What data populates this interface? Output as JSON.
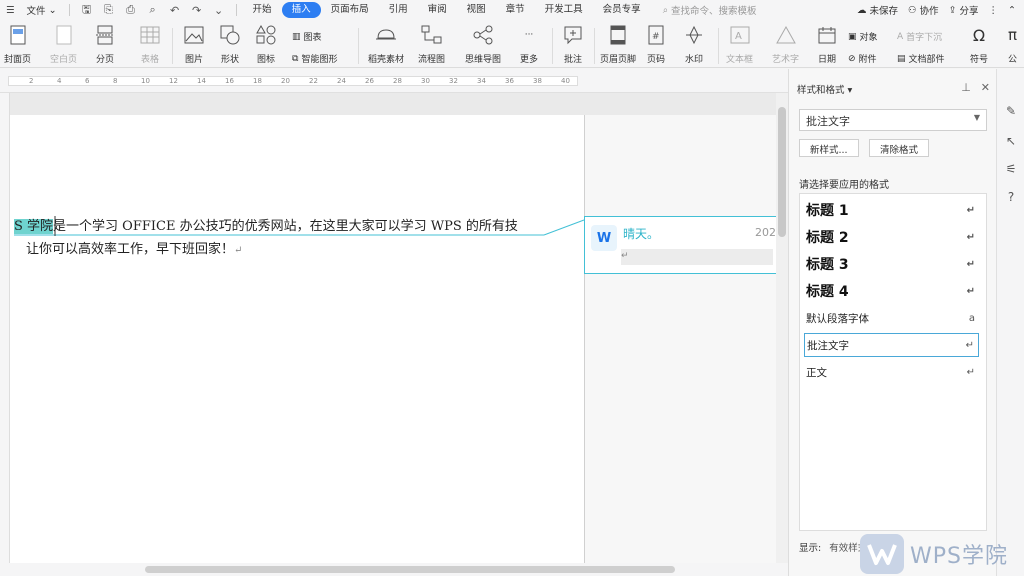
{
  "menubar": {
    "file": "文件",
    "tabs": [
      "开始",
      "插入",
      "页面布局",
      "引用",
      "审阅",
      "视图",
      "章节",
      "开发工具",
      "会员专享"
    ],
    "active_tab": "插入",
    "search_placeholder": "查找命令、搜索模板",
    "unsaved": "未保存",
    "collab": "协作",
    "share": "分享"
  },
  "ribbon": {
    "cover": "封面页",
    "blank_page": "空白页",
    "page_break": "分页",
    "table": "表格",
    "picture": "图片",
    "shape": "形状",
    "icon": "图标",
    "chart": "图表",
    "smart_art": "智能图形",
    "stock": "稻壳素材",
    "flowchart": "流程图",
    "mindmap": "思维导图",
    "more": "更多",
    "comment": "批注",
    "header_footer": "页眉页脚",
    "page_number": "页码",
    "watermark": "水印",
    "textbox": "文本框",
    "wordart": "艺术字",
    "date": "日期",
    "object": "对象",
    "attachment": "附件",
    "dropcap": "首字下沉",
    "doc_parts": "文档部件",
    "symbol": "符号",
    "formula": "公"
  },
  "ruler": {
    "ticks": [
      "2",
      "4",
      "6",
      "8",
      "10",
      "12",
      "14",
      "16",
      "18",
      "20",
      "22",
      "24",
      "26",
      "28",
      "30",
      "32",
      "34",
      "36",
      "38",
      "40"
    ]
  },
  "document": {
    "highlight": "S 学院",
    "line1_rest": "是一个学习 OFFICE 办公技巧的优秀网站，在这里大家可以学习 WPS 的所有技",
    "line2": "让你可以高效率工作，早下班回家！",
    "para_mark": "↵"
  },
  "comment": {
    "author": "晴天。",
    "date": "202",
    "para_mark": "↵",
    "avatar": "W"
  },
  "panel": {
    "title": "样式和格式",
    "current_style": "批注文字",
    "new_style": "新样式...",
    "clear_format": "清除格式",
    "choose_label": "请选择要应用的格式",
    "styles": [
      {
        "name": "标题  1",
        "mark": "↵"
      },
      {
        "name": "标题  2",
        "mark": "↵"
      },
      {
        "name": "标题  3",
        "mark": "↵"
      },
      {
        "name": "标题  4",
        "mark": "↵"
      },
      {
        "name": "默认段落字体",
        "mark": "a"
      },
      {
        "name": "批注文字",
        "mark": "↵"
      },
      {
        "name": "正文",
        "mark": "↵"
      }
    ],
    "show_label": "显示:",
    "show_value": "有效样式"
  },
  "watermark": {
    "text": "WPS学院"
  },
  "colors": {
    "accent": "#2d7ef2",
    "highlight": "#6fd3cf",
    "comment_border": "#43c0d6"
  }
}
